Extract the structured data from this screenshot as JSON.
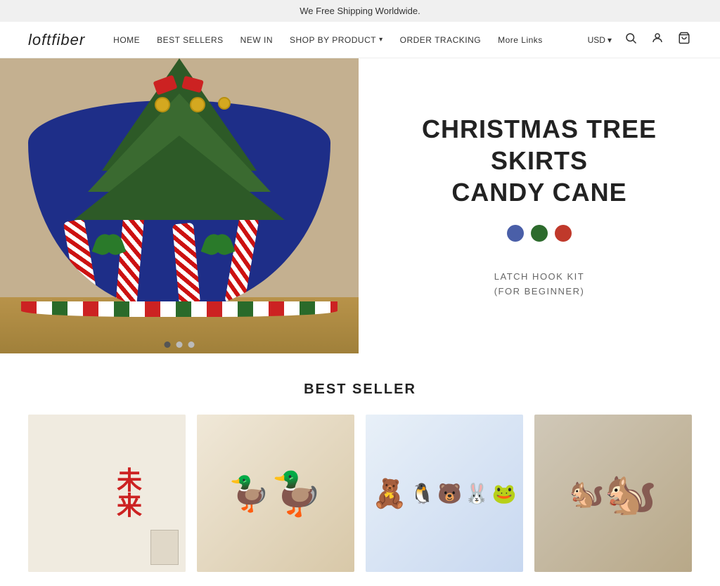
{
  "topBanner": {
    "text": "We Free Shipping Worldwide."
  },
  "header": {
    "logo": "loftfiber",
    "nav": [
      {
        "label": "HOME",
        "hasDropdown": false
      },
      {
        "label": "BEST SELLERS",
        "hasDropdown": false
      },
      {
        "label": "NEW IN",
        "hasDropdown": false
      },
      {
        "label": "SHOP BY PRODUCT",
        "hasDropdown": true
      },
      {
        "label": "ORDER TRACKING",
        "hasDropdown": false
      },
      {
        "label": "More Links",
        "hasDropdown": false
      }
    ],
    "currency": "USD",
    "currencyArrow": "▾"
  },
  "hero": {
    "title_line1": "CHRISTMAS TREE SKIRTS",
    "title_line2": "CANDY CANE",
    "swatches": [
      {
        "color": "#4a5fa8",
        "label": "Blue"
      },
      {
        "color": "#2d6b2d",
        "label": "Green"
      },
      {
        "color": "#c0392b",
        "label": "Red"
      }
    ],
    "subtitle_line1": "LATCH HOOK KIT",
    "subtitle_line2": "(FOR BEGINNER)",
    "dots": [
      {
        "active": true
      },
      {
        "active": false
      },
      {
        "active": false
      }
    ]
  },
  "bestSeller": {
    "title": "BEST SELLER",
    "products": [
      {
        "id": 1,
        "alt": "Product 1 - Chinese character craft"
      },
      {
        "id": 2,
        "alt": "Product 2 - Duck plush"
      },
      {
        "id": 3,
        "alt": "Product 3 - Mixed plush toys"
      },
      {
        "id": 4,
        "alt": "Product 4 - Acorn character"
      }
    ]
  },
  "icons": {
    "search": "🔍",
    "user": "👤",
    "cart": "🛒",
    "dropdown_arrow": "▾"
  }
}
